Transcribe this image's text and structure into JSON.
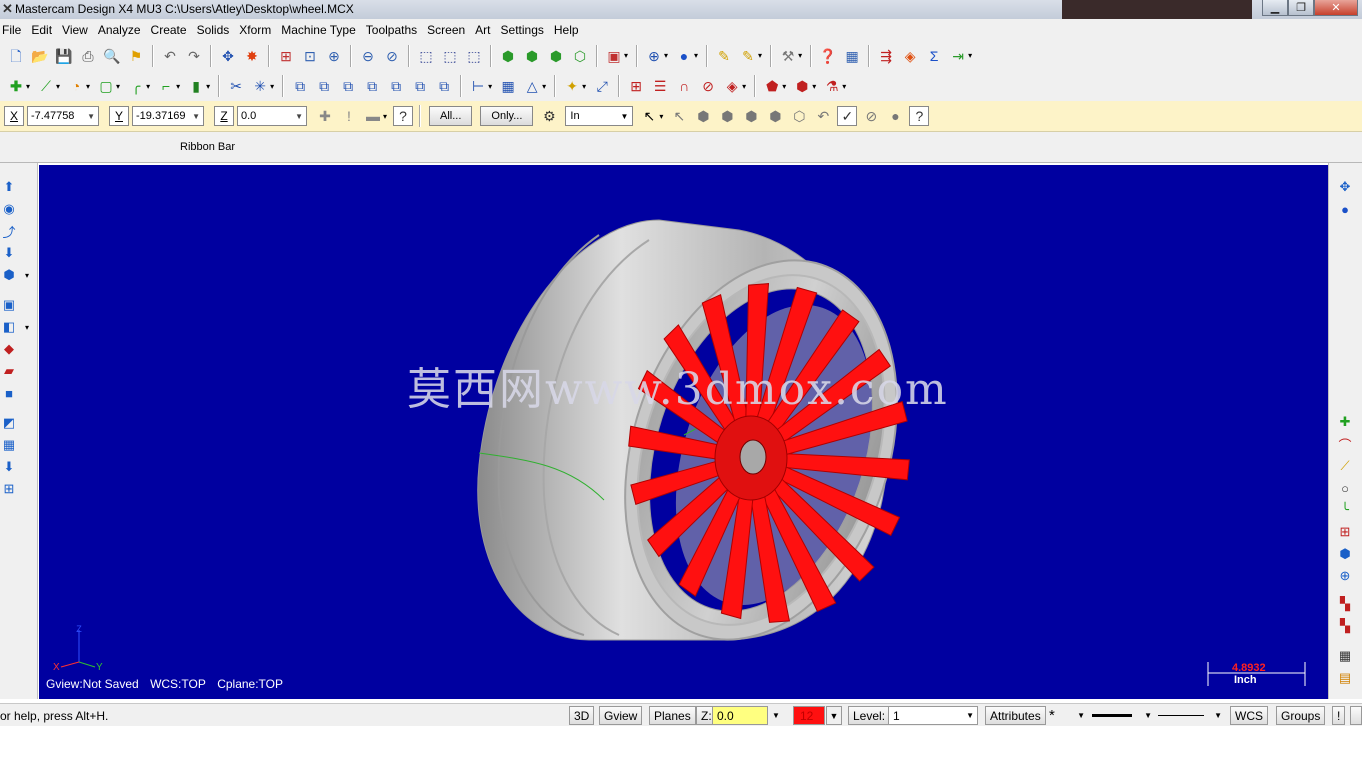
{
  "window": {
    "title": "Mastercam Design X4 MU3  C:\\Users\\Atley\\Desktop\\wheel.MCX"
  },
  "menu": [
    "File",
    "Edit",
    "View",
    "Analyze",
    "Create",
    "Solids",
    "Xform",
    "Machine Type",
    "Toolpaths",
    "Screen",
    "Art",
    "Settings",
    "Help"
  ],
  "ribbon": {
    "x_label": "X",
    "x_value": "-7.47758",
    "y_label": "Y",
    "y_value": "-19.37169",
    "z_label": "Z",
    "z_value": "0.0",
    "all_button": "All...",
    "only_button": "Only...",
    "units_select": "In",
    "bar_label": "Ribbon Bar"
  },
  "viewport": {
    "background": "#0000a0",
    "watermark": "莫西网www.3dmox.com",
    "gview": "Gview:Not Saved",
    "wcs": "WCS:TOP",
    "cplane": "Cplane:TOP",
    "axis_x": "X",
    "axis_y": "Y",
    "scale_value": "4.8932",
    "scale_unit": "Inch",
    "wheel_rim_color": "#bcbcbc",
    "wheel_spoke_color": "#ff1010"
  },
  "status": {
    "help": "or help, press Alt+H.",
    "btn_3d": "3D",
    "btn_gview": "Gview",
    "btn_planes": "Planes",
    "z_label": "Z:",
    "z_value": "0.0",
    "color_value": "12",
    "level_label": "Level:",
    "level_value": "1",
    "attributes": "Attributes",
    "point_style": "*",
    "wcs": "WCS",
    "groups": "Groups",
    "exclaim": "!"
  }
}
